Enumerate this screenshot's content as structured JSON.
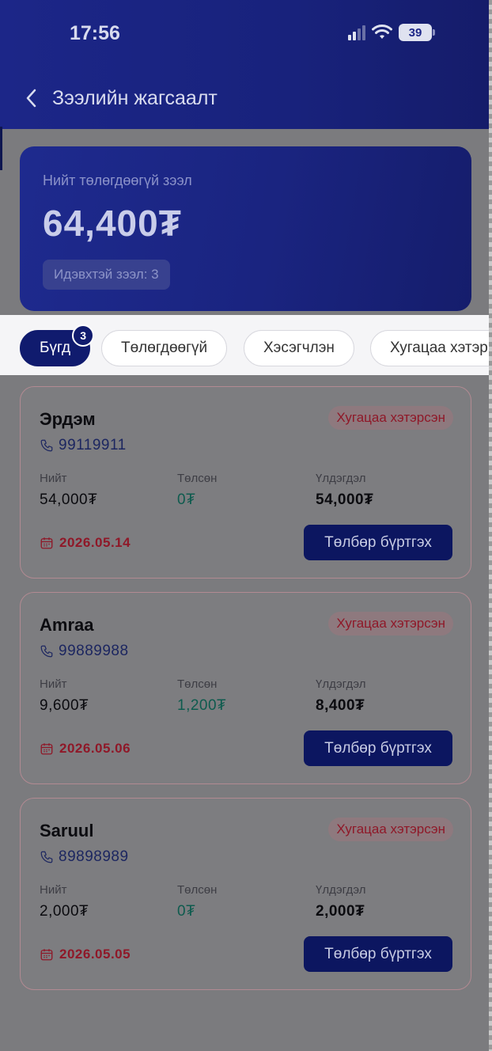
{
  "status_bar": {
    "time": "17:56",
    "battery": "39"
  },
  "header": {
    "title": "Зээлийн жагсаалт"
  },
  "summary": {
    "label": "Нийт төлөгдөөгүй зээл",
    "amount": "64,400₮",
    "active_loans": "Идэвхтэй зээл: 3"
  },
  "filters": [
    {
      "label": "Бүгд",
      "count": "3",
      "active": true
    },
    {
      "label": "Төлөгдөөгүй"
    },
    {
      "label": "Хэсэгчлэн"
    },
    {
      "label": "Хугацаа хэтэр"
    }
  ],
  "loan_labels": {
    "total": "Нийт",
    "paid": "Төлсөн",
    "remaining": "Үлдэгдэл",
    "pay_button": "Төлбөр бүртгэх"
  },
  "loans": [
    {
      "name": "Эрдэм",
      "phone": "99119911",
      "status": "Хугацаа хэтэрсэн",
      "total": "54,000₮",
      "paid": "0₮",
      "remaining": "54,000₮",
      "due_date": "2026.05.14"
    },
    {
      "name": "Amraa",
      "phone": "99889988",
      "status": "Хугацаа хэтэрсэн",
      "total": "9,600₮",
      "paid": "1,200₮",
      "remaining": "8,400₮",
      "due_date": "2026.05.06"
    },
    {
      "name": "Saruul",
      "phone": "89898989",
      "status": "Хугацаа хэтэрсэн",
      "total": "2,000₮",
      "paid": "0₮",
      "remaining": "2,000₮",
      "due_date": "2026.05.05"
    }
  ],
  "colors": {
    "primary": "#101b6e",
    "overdue": "#c8273e",
    "paid": "#1a9a83"
  }
}
